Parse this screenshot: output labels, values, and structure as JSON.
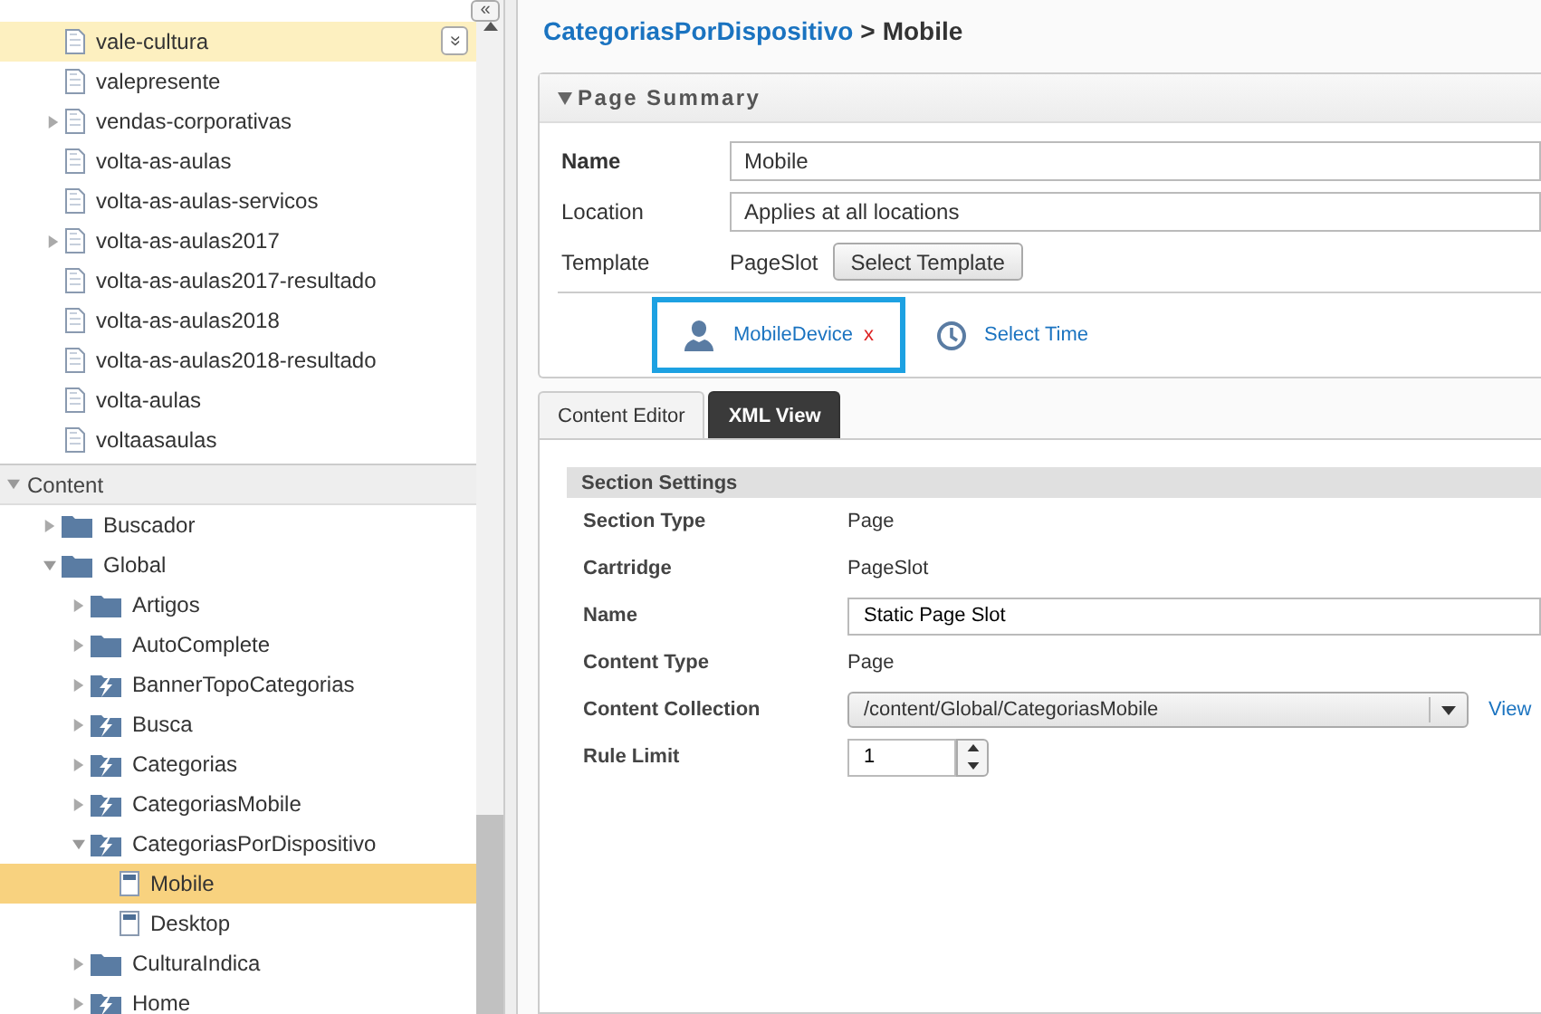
{
  "sidebar": {
    "collapse_button": "«",
    "pages": [
      {
        "label": "vale-cultura",
        "kind": "page",
        "expandable": false,
        "highlighted": true,
        "menu_button": "»"
      },
      {
        "label": "valepresente",
        "kind": "page",
        "expandable": false,
        "highlighted": false
      },
      {
        "label": "vendas-corporativas",
        "kind": "page",
        "expandable": true,
        "highlighted": false
      },
      {
        "label": "volta-as-aulas",
        "kind": "page",
        "expandable": false,
        "highlighted": false
      },
      {
        "label": "volta-as-aulas-servicos",
        "kind": "page",
        "expandable": false,
        "highlighted": false
      },
      {
        "label": "volta-as-aulas2017",
        "kind": "page",
        "expandable": true,
        "highlighted": false
      },
      {
        "label": "volta-as-aulas2017-resultado",
        "kind": "page",
        "expandable": false,
        "highlighted": false
      },
      {
        "label": "volta-as-aulas2018",
        "kind": "page",
        "expandable": false,
        "highlighted": false
      },
      {
        "label": "volta-as-aulas2018-resultado",
        "kind": "page",
        "expandable": false,
        "highlighted": false
      },
      {
        "label": "volta-aulas",
        "kind": "page",
        "expandable": false,
        "highlighted": false
      },
      {
        "label": "voltaasaulas",
        "kind": "page",
        "expandable": false,
        "highlighted": false
      }
    ],
    "content_section": {
      "title": "Content",
      "expanded": true,
      "tree": [
        {
          "label": "Buscador",
          "kind": "folder",
          "expanded": false,
          "selected": false
        },
        {
          "label": "Global",
          "kind": "folder",
          "expanded": true,
          "selected": false,
          "children": [
            {
              "label": "Artigos",
              "kind": "folder",
              "expanded": false,
              "selected": false
            },
            {
              "label": "AutoComplete",
              "kind": "folder",
              "expanded": false,
              "selected": false
            },
            {
              "label": "BannerTopoCategorias",
              "kind": "slot",
              "expanded": false,
              "selected": false
            },
            {
              "label": "Busca",
              "kind": "slot",
              "expanded": false,
              "selected": false
            },
            {
              "label": "Categorias",
              "kind": "slot",
              "expanded": false,
              "selected": false
            },
            {
              "label": "CategoriasMobile",
              "kind": "slot",
              "expanded": false,
              "selected": false
            },
            {
              "label": "CategoriasPorDispositivo",
              "kind": "slot",
              "expanded": true,
              "selected": false,
              "children": [
                {
                  "label": "Mobile",
                  "kind": "item",
                  "selected": true
                },
                {
                  "label": "Desktop",
                  "kind": "item",
                  "selected": false
                }
              ]
            },
            {
              "label": "CulturaIndica",
              "kind": "folder",
              "expanded": false,
              "selected": false
            },
            {
              "label": "Home",
              "kind": "slot",
              "expanded": false,
              "selected": false
            }
          ]
        }
      ]
    }
  },
  "breadcrumb": {
    "parent": "CategoriasPorDispositivo",
    "separator": ">",
    "current": "Mobile"
  },
  "page_summary": {
    "title": "Page Summary",
    "expanded": true,
    "name": {
      "label": "Name",
      "value": "Mobile"
    },
    "location": {
      "label": "Location",
      "value": "Applies at all locations"
    },
    "template": {
      "label": "Template",
      "value": "PageSlot",
      "button": "Select Template"
    },
    "triggers": [
      {
        "kind": "user",
        "label": "MobileDevice",
        "remove": "x",
        "selected": true
      },
      {
        "kind": "time",
        "label": "Select Time",
        "selected": false
      }
    ]
  },
  "tabs": [
    {
      "label": "Content Editor",
      "selected": false
    },
    {
      "label": "XML View",
      "selected": true
    }
  ],
  "section_settings": {
    "title": "Section Settings",
    "rows": [
      {
        "kind": "text",
        "label": "Section Type",
        "value": "Page"
      },
      {
        "kind": "text",
        "label": "Cartridge",
        "value": "PageSlot"
      },
      {
        "kind": "input",
        "label": "Name",
        "value": "Static Page Slot"
      },
      {
        "kind": "text",
        "label": "Content Type",
        "value": "Page"
      },
      {
        "kind": "select",
        "label": "Content Collection",
        "value": "/content/Global/CategoriasMobile",
        "link": "View"
      },
      {
        "kind": "spinner",
        "label": "Rule Limit",
        "value": "1"
      }
    ]
  }
}
